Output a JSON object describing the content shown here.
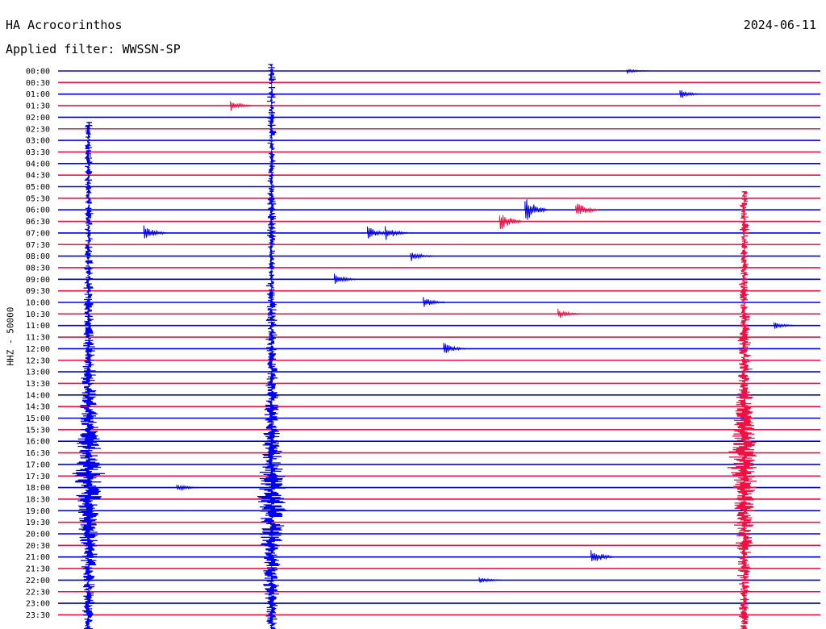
{
  "header": {
    "station": "HA Acrocorinthos",
    "date": "2024-06-11",
    "filter": "Applied filter: WWSSN-SP",
    "channel_label": "HHZ - 50000"
  },
  "colors": {
    "trace_a": "#0000ee",
    "trace_b": "#ee1144"
  },
  "chart_data": {
    "type": "line",
    "title": "HA Acrocorinthos",
    "subtitle": "Applied filter: WWSSN-SP",
    "date": "2024-06-11",
    "ylabel": "HHZ - 50000",
    "xlabel": "",
    "x_unit": "minutes within each 30-minute row",
    "xlim": [
      0,
      30
    ],
    "rows": [
      "00:00",
      "00:30",
      "01:00",
      "01:30",
      "02:00",
      "02:30",
      "03:00",
      "03:30",
      "04:00",
      "04:30",
      "05:00",
      "05:30",
      "06:00",
      "06:30",
      "07:00",
      "07:30",
      "08:00",
      "08:30",
      "09:00",
      "09:30",
      "10:00",
      "10:30",
      "11:00",
      "11:30",
      "12:00",
      "12:30",
      "13:00",
      "13:30",
      "14:00",
      "14:30",
      "15:00",
      "15:30",
      "16:00",
      "16:30",
      "17:00",
      "17:30",
      "18:00",
      "18:30",
      "19:00",
      "19:30",
      "20:00",
      "20:30",
      "21:00",
      "21:30",
      "22:00",
      "22:30",
      "23:00",
      "23:30"
    ],
    "row_colors": [
      "#0000ee",
      "#ee1144"
    ],
    "events": [
      {
        "row": 0,
        "minute": 22.5,
        "amplitude": 0.3,
        "color": "#0000ee"
      },
      {
        "row": 2,
        "minute": 24.6,
        "amplitude": 0.6,
        "color": "#0000ee"
      },
      {
        "row": 3,
        "minute": 6.9,
        "amplitude": 0.7,
        "color": "#ee1144"
      },
      {
        "row": 12,
        "minute": 18.5,
        "amplitude": 1.8,
        "color": "#0000ee"
      },
      {
        "row": 12,
        "minute": 20.5,
        "amplitude": 1.2,
        "color": "#ee1144"
      },
      {
        "row": 13,
        "minute": 17.5,
        "amplitude": 1.4,
        "color": "#ee1144"
      },
      {
        "row": 14,
        "minute": 3.5,
        "amplitude": 1.0,
        "color": "#0000ee"
      },
      {
        "row": 14,
        "minute": 12.3,
        "amplitude": 1.0,
        "color": "#0000ee"
      },
      {
        "row": 14,
        "minute": 13.0,
        "amplitude": 1.0,
        "color": "#0000ee"
      },
      {
        "row": 16,
        "minute": 14.0,
        "amplitude": 0.7,
        "color": "#0000ee"
      },
      {
        "row": 18,
        "minute": 11.0,
        "amplitude": 0.7,
        "color": "#0000ee"
      },
      {
        "row": 20,
        "minute": 14.5,
        "amplitude": 0.7,
        "color": "#0000ee"
      },
      {
        "row": 21,
        "minute": 19.8,
        "amplitude": 0.7,
        "color": "#ee1144"
      },
      {
        "row": 22,
        "minute": 28.3,
        "amplitude": 0.5,
        "color": "#0000ee"
      },
      {
        "row": 24,
        "minute": 15.3,
        "amplitude": 0.8,
        "color": "#0000ee"
      },
      {
        "row": 36,
        "minute": 4.8,
        "amplitude": 0.5,
        "color": "#0000ee"
      },
      {
        "row": 42,
        "minute": 21.1,
        "amplitude": 1.2,
        "color": "#0000ee"
      },
      {
        "row": 44,
        "minute": 16.7,
        "amplitude": 0.4,
        "color": "#0000ee"
      }
    ],
    "large_events": [
      {
        "start_row": 5,
        "end_row": 47,
        "minute": 1.2,
        "peak_row": 35,
        "color": "#0000ee"
      },
      {
        "start_row": 0,
        "end_row": 47,
        "minute": 8.4,
        "peak_row": 37,
        "color": "#0000ee"
      },
      {
        "start_row": 11,
        "end_row": 47,
        "minute": 27.0,
        "peak_row": 34,
        "color": "#ee1144"
      }
    ],
    "grid": false,
    "legend": "none"
  }
}
